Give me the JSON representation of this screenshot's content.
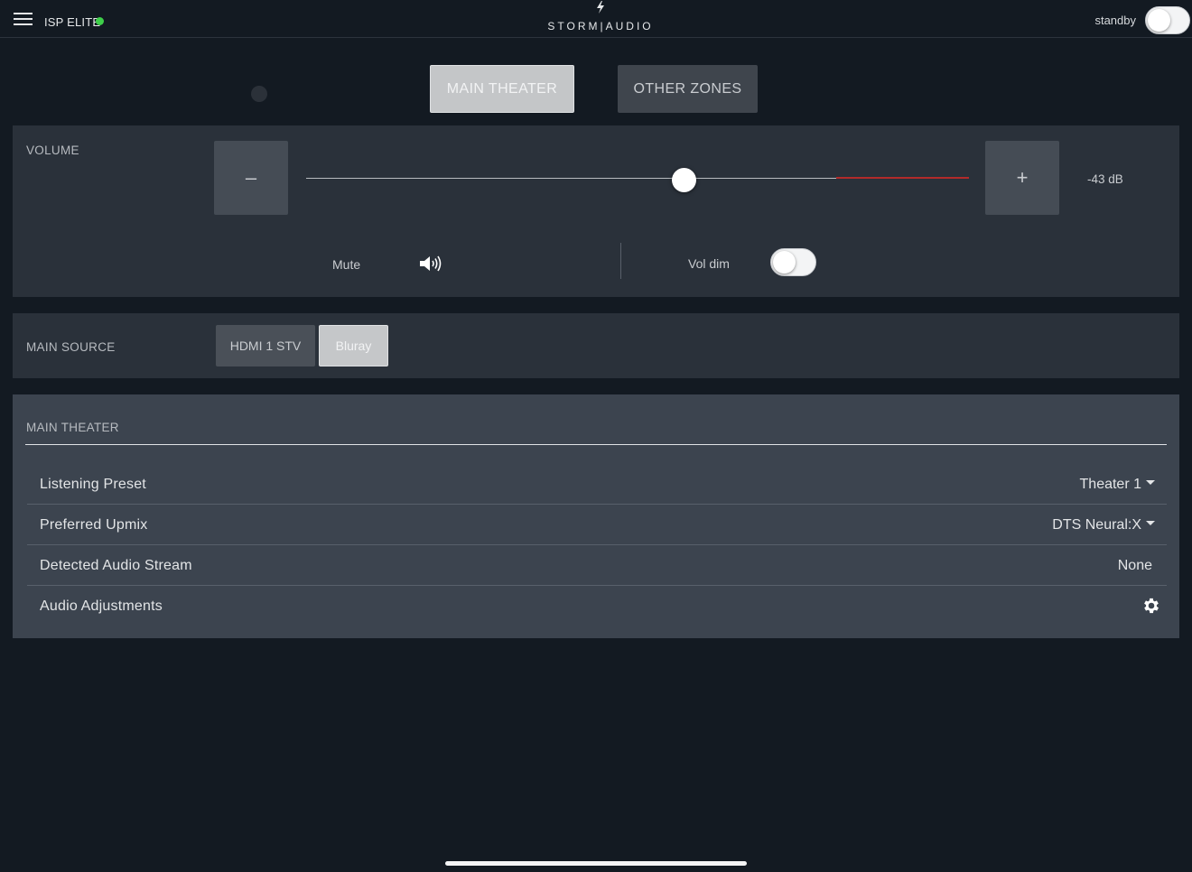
{
  "header": {
    "device_name": "ISP ELITE",
    "status_color": "#3ecf4a",
    "logo_text": "STORM|AUDIO",
    "standby_label": "standby",
    "standby_on": false
  },
  "zones": {
    "tabs": [
      {
        "label": "MAIN THEATER",
        "selected": true
      },
      {
        "label": "OTHER ZONES",
        "selected": false
      }
    ]
  },
  "volume": {
    "title": "VOLUME",
    "minus_label": "–",
    "plus_label": "+",
    "level_fraction": 0.57,
    "limit_start_fraction": 0.8,
    "readout": "-43 dB",
    "mute_label": "Mute",
    "muted": false,
    "voldim_label": "Vol dim",
    "voldim_on": false
  },
  "source": {
    "title": "MAIN SOURCE",
    "options": [
      {
        "label": "HDMI 1 STV",
        "selected": false
      },
      {
        "label": "Bluray",
        "selected": true
      }
    ]
  },
  "theater": {
    "title": "MAIN THEATER",
    "rows": [
      {
        "label": "Listening Preset",
        "value": "Theater 1",
        "dropdown": true
      },
      {
        "label": "Preferred Upmix",
        "value": "DTS Neural:X",
        "dropdown": true
      },
      {
        "label": "Detected Audio Stream",
        "value": "None",
        "dropdown": false
      },
      {
        "label": "Audio Adjustments",
        "icon": "gear-icon"
      }
    ]
  },
  "colors": {
    "background": "#131a22",
    "panel": "#2a313a",
    "theater_panel": "#3c444f",
    "volume_limit": "#b22a2a"
  }
}
